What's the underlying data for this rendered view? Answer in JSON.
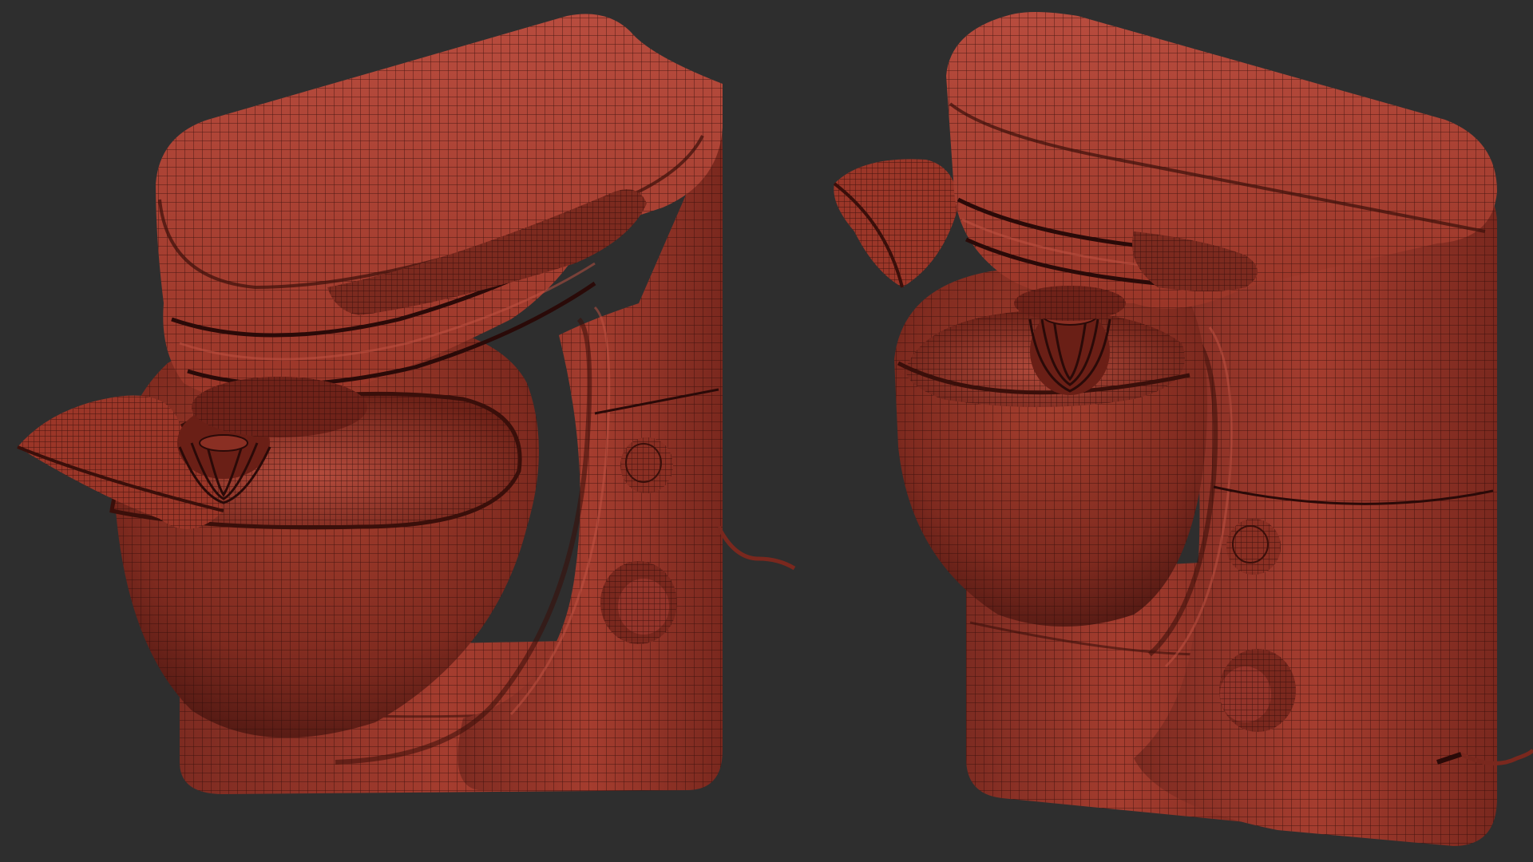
{
  "scene": {
    "background_color": "#2e2e2e",
    "mesh_color": "#9e3a2c",
    "mesh_highlight_color": "#c4574a",
    "mesh_shadow_color": "#4f1812",
    "wire_color": "#2a0a08",
    "views": [
      {
        "subject": "stand-mixer-wireframe",
        "angle": "front-left"
      },
      {
        "subject": "stand-mixer-wireframe",
        "angle": "front-right"
      }
    ]
  }
}
